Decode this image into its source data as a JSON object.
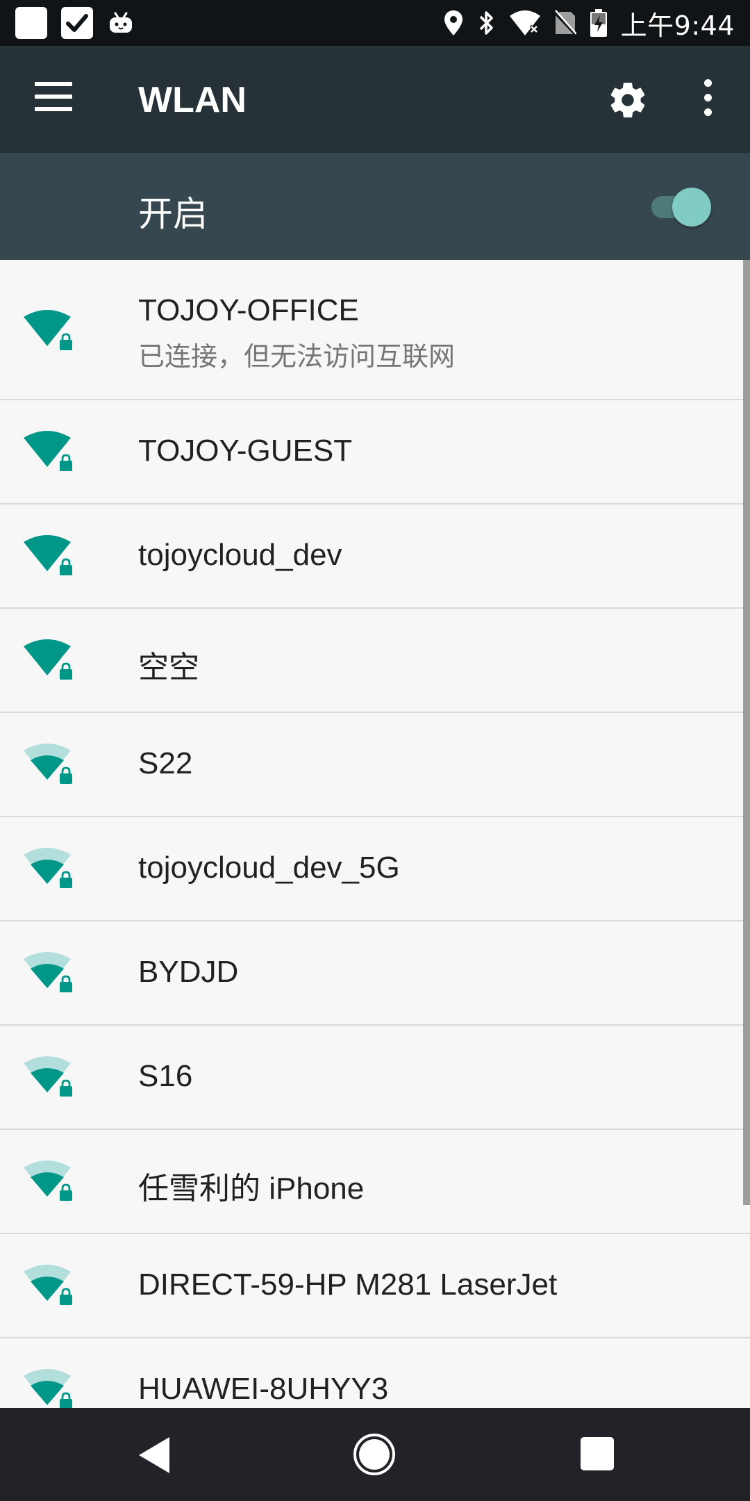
{
  "status_bar": {
    "time": "上午9:44",
    "icons": [
      "notification-square-icon",
      "checkmark-app-icon",
      "bilibili-icon",
      "location-icon",
      "bluetooth-icon",
      "wifi-no-internet-icon",
      "no-sim-icon",
      "battery-charging-icon"
    ]
  },
  "app_bar": {
    "title": "WLAN",
    "icons": [
      "menu-icon",
      "settings-gear-icon",
      "more-vert-icon"
    ]
  },
  "wifi_switch": {
    "label": "开启",
    "enabled": true
  },
  "colors": {
    "app_bar": "#263238",
    "switch_bar": "#37474f",
    "accent": "#009688",
    "wifi_weak": "#b2dfdb",
    "toggle_thumb": "#80cbc4"
  },
  "networks": [
    {
      "name": "TOJOY-OFFICE",
      "status": "已连接，但无法访问互联网",
      "signal": "full",
      "secured": true
    },
    {
      "name": "TOJOY-GUEST",
      "signal": "full",
      "secured": true
    },
    {
      "name": "tojoycloud_dev",
      "signal": "full",
      "secured": true
    },
    {
      "name": "空空",
      "signal": "full",
      "secured": true
    },
    {
      "name": "S22",
      "signal": "medium",
      "secured": true
    },
    {
      "name": "tojoycloud_dev_5G",
      "signal": "medium",
      "secured": true
    },
    {
      "name": "BYDJD",
      "signal": "medium",
      "secured": true
    },
    {
      "name": "S16",
      "signal": "medium",
      "secured": true
    },
    {
      "name": "任雪利的 iPhone",
      "signal": "medium",
      "secured": true
    },
    {
      "name": "DIRECT-59-HP M281 LaserJet",
      "signal": "medium",
      "secured": true
    },
    {
      "name": "HUAWEI-8UHYY3",
      "signal": "medium",
      "secured": true
    }
  ],
  "nav_bar": {
    "buttons": [
      "back-icon",
      "home-icon",
      "recents-icon"
    ]
  }
}
